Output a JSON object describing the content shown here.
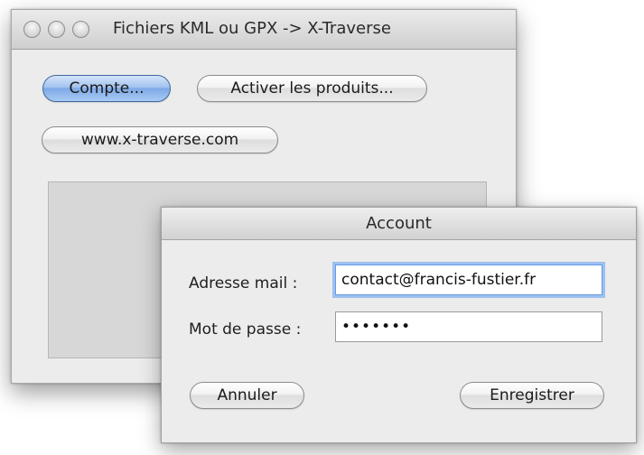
{
  "main_window": {
    "title": "Fichiers KML ou GPX -> X-Traverse",
    "buttons": {
      "compte": "Compte...",
      "activer": "Activer les produits...",
      "website": "www.x-traverse.com"
    }
  },
  "account_sheet": {
    "title": "Account",
    "email_label": "Adresse mail :",
    "email_value": "contact@francis-fustier.fr",
    "password_label": "Mot de passe :",
    "password_mask": "•••••••",
    "cancel_label": "Annuler",
    "save_label": "Enregistrer"
  },
  "colors": {
    "default_button": "#8fb6ee",
    "focus_ring": "#9cc0f1",
    "window_background": "#ececec"
  }
}
